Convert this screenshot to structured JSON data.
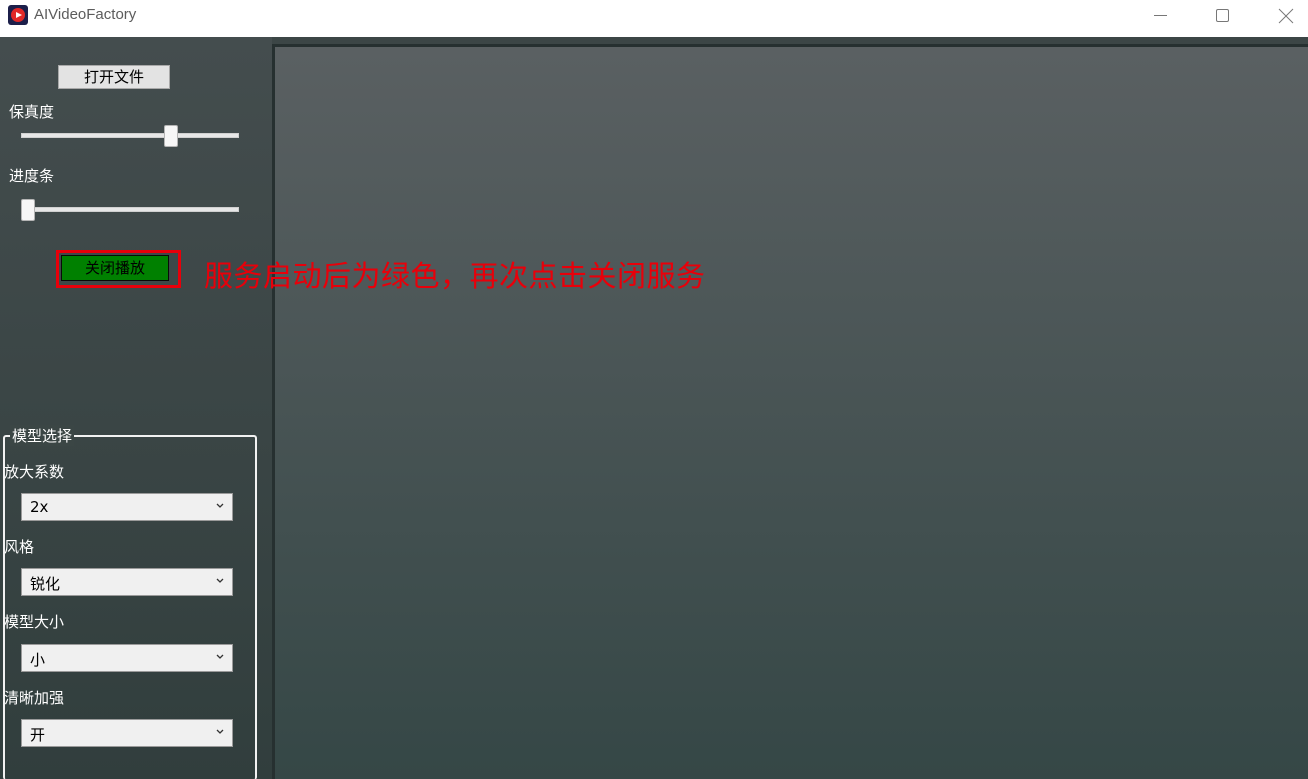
{
  "window": {
    "title": "AIVideoFactory",
    "controls": {
      "minimize_icon": "minimize-icon",
      "maximize_icon": "maximize-icon",
      "close_icon": "close-icon"
    }
  },
  "left_panel": {
    "open_file_label": "打开文件",
    "fidelity_label": "保真度",
    "fidelity_value": 0.7,
    "progress_label": "进度条",
    "progress_value": 0,
    "close_play_label": "关闭播放",
    "close_play_color": "#008000"
  },
  "annotation": {
    "text": "服务启动后为绿色，再次点击关闭服务",
    "color": "#e8000a"
  },
  "model_group": {
    "title": "模型选择",
    "scale": {
      "label": "放大系数",
      "value": "2x"
    },
    "style": {
      "label": "风格",
      "value": "锐化"
    },
    "size": {
      "label": "模型大小",
      "value": "小"
    },
    "clarity": {
      "label": "清晰加强",
      "value": "开"
    }
  }
}
